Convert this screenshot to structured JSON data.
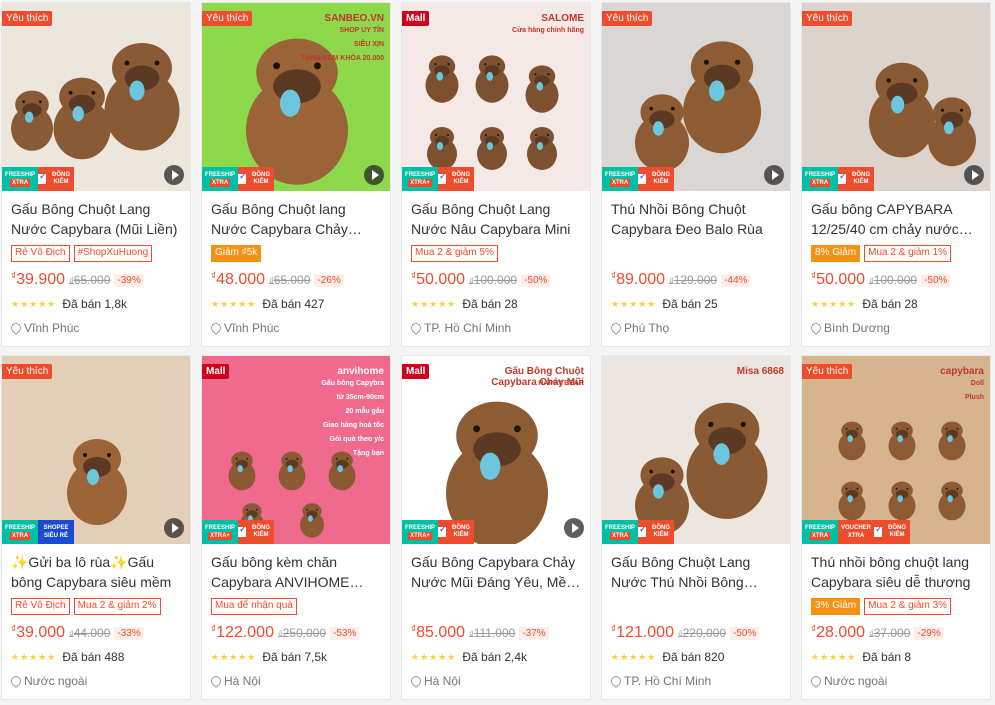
{
  "colors": {
    "accent": "#ee4d2d",
    "star": "#ffce3d",
    "mall": "#d0011b"
  },
  "products": [
    {
      "title": "Gấu Bông Chuột Lang Nước Capybara (Mũi Liền)",
      "badge": "Yêu thích",
      "badge_type": "fav",
      "tags": [
        {
          "text": "Rẻ Vô Địch",
          "style": "outline"
        },
        {
          "text": "#ShopXuHuong",
          "style": "outline"
        }
      ],
      "currency": "₫",
      "price": "39.900",
      "old_price": "65.000",
      "discount": "-39%",
      "stars": "★★★★★",
      "sold": "Đã bán 1,8k",
      "location": "Vĩnh Phúc",
      "bottom_badges": [
        "freeship",
        "check"
      ],
      "video": true,
      "bg": "#ede6dd",
      "img_text": []
    },
    {
      "title": "Gấu Bông Chuột lang Nước Capybara Chảy Nước Mũi",
      "badge": "Yêu thích",
      "badge_type": "fav",
      "tags": [
        {
          "text": "Giảm ₫5k",
          "style": "fill"
        }
      ],
      "currency": "₫",
      "price": "48.000",
      "old_price": "65.000",
      "discount": "-26%",
      "stars": "★★★★★",
      "sold": "Đã bán 427",
      "location": "Vĩnh Phúc",
      "bottom_badges": [
        "freeship",
        "check"
      ],
      "video": true,
      "bg": "#8ed84b",
      "img_text": [
        "SANBEO.VN",
        "SHOP UY TÍN",
        "SIÊU XỊN",
        "TẶNG KÈM KHÓA 20.000"
      ]
    },
    {
      "title": "Gấu Bông Chuột Lang Nước Nâu Capybara Mini",
      "badge": "Mall",
      "badge_type": "mall",
      "tags": [
        {
          "text": "Mua 2 & giảm 5%",
          "style": "outline"
        }
      ],
      "currency": "₫",
      "price": "50.000",
      "old_price": "100.000",
      "discount": "-50%",
      "stars": "★★★★★",
      "sold": "Đã bán 28",
      "location": "TP. Hồ Chí Minh",
      "bottom_badges": [
        "xtra",
        "check"
      ],
      "video": false,
      "bg": "#f4e9e6",
      "img_text": [
        "SALOME",
        "Cửa hàng chính hãng"
      ]
    },
    {
      "title": "Thú Nhồi Bông Chuột Capybara Đeo Balo Rùa",
      "badge": "Yêu thích",
      "badge_type": "fav",
      "tags": [],
      "currency": "₫",
      "price": "89.000",
      "old_price": "129.000",
      "discount": "-44%",
      "stars": "★★★★★",
      "sold": "Đã bán 25",
      "location": "Phú Thọ",
      "bottom_badges": [
        "freeship",
        "check"
      ],
      "video": true,
      "bg": "#d9d6d4",
      "img_text": []
    },
    {
      "title": "Gấu bông CAPYBARA 12/25/40 cm chảy nước mũi",
      "badge": "Yêu thích",
      "badge_type": "fav",
      "tags": [
        {
          "text": "8% Giảm",
          "style": "fill"
        },
        {
          "text": "Mua 2 & giảm 1%",
          "style": "outline"
        }
      ],
      "currency": "₫",
      "price": "50.000",
      "old_price": "100.000",
      "discount": "-50%",
      "stars": "★★★★★",
      "sold": "Đã bán 28",
      "location": "Bình Dương",
      "bottom_badges": [
        "freeship",
        "check"
      ],
      "video": true,
      "bg": "#dcd4cc",
      "img_text": []
    },
    {
      "title": "✨Gửi ba lô rùa✨Gấu bông Capybara siêu mềm",
      "badge": "Yêu thích",
      "badge_type": "fav",
      "tags": [
        {
          "text": "Rẻ Vô Địch",
          "style": "outline"
        },
        {
          "text": "Mua 2 & giảm 2%",
          "style": "outline"
        }
      ],
      "currency": "₫",
      "price": "39.000",
      "old_price": "44.000",
      "discount": "-33%",
      "stars": "★★★★★",
      "sold": "Đã bán 488",
      "location": "Nước ngoài",
      "bottom_badges": [
        "freeship",
        "shopee"
      ],
      "video": true,
      "bg": "#e3cfb8",
      "img_text": []
    },
    {
      "title": "Gấu bông kèm chăn Capybara ANVIHOME Đáng Yêu",
      "badge": "Mall",
      "badge_type": "mall",
      "tags": [
        {
          "text": "Mua để nhận quà",
          "style": "outline"
        }
      ],
      "currency": "₫",
      "price": "122.000",
      "old_price": "250.000",
      "discount": "-53%",
      "stars": "★★★★★",
      "sold": "Đã bán 7,5k",
      "location": "Hà Nội",
      "bottom_badges": [
        "xtra",
        "check"
      ],
      "video": false,
      "bg": "#f06a8e",
      "img_text": [
        "anvihome",
        "Gấu bông Capybra",
        "từ 35cm-90cm",
        "20 mẫu gấu",
        "Giao hàng hoả tốc",
        "Gói quà theo y/c",
        "Tặng bạn"
      ]
    },
    {
      "title": "Gấu Bông Capybara Chảy Nước Mũi Đáng Yêu, Mềm Mại",
      "badge": "Mall",
      "badge_type": "mall",
      "tags": [],
      "currency": "₫",
      "price": "85.000",
      "old_price": "111.000",
      "discount": "-37%",
      "stars": "★★★★★",
      "sold": "Đã bán 2,4k",
      "location": "Hà Nội",
      "bottom_badges": [
        "xtra",
        "check"
      ],
      "video": true,
      "bg": "#ffffff",
      "img_text": [
        "Gấu Bông Chuột Capybara Chảy Mũi",
        "HAPPY BEAR"
      ]
    },
    {
      "title": "Gấu Bông Chuột Lang Nước Thú Nhồi Bông Capybara",
      "badge": "",
      "badge_type": "none",
      "tags": [],
      "currency": "₫",
      "price": "121.000",
      "old_price": "220.000",
      "discount": "-50%",
      "stars": "★★★★★",
      "sold": "Đã bán 820",
      "location": "TP. Hồ Chí Minh",
      "bottom_badges": [
        "freeship",
        "check"
      ],
      "video": false,
      "bg": "#ece6e0",
      "img_text": [
        "Misa 6868"
      ]
    },
    {
      "title": "Thú nhồi bông chuột lang Capybara siêu dễ thương",
      "badge": "Yêu thích",
      "badge_type": "fav",
      "tags": [
        {
          "text": "3% Giảm",
          "style": "fill"
        },
        {
          "text": "Mua 2 & giảm 3%",
          "style": "outline"
        }
      ],
      "currency": "₫",
      "price": "28.000",
      "old_price": "37.000",
      "discount": "-29%",
      "stars": "★★★★★",
      "sold": "Đã bán 8",
      "location": "Nước ngoài",
      "bottom_badges": [
        "freeship",
        "voucher",
        "check"
      ],
      "video": false,
      "bg": "#d6b48e",
      "img_text": [
        "capybara",
        "Doll",
        "Plush"
      ]
    }
  ],
  "badge_labels": {
    "freeship": "FREESHIP",
    "xtra": "XTRA",
    "check": "ĐỒNG KIỂM",
    "shopee": "SHOPEE",
    "shopee2": "SIÊU RẺ",
    "voucher": "VOUCHER",
    "voucher2": "XTRA",
    "xtraplus": "XTRA+"
  }
}
